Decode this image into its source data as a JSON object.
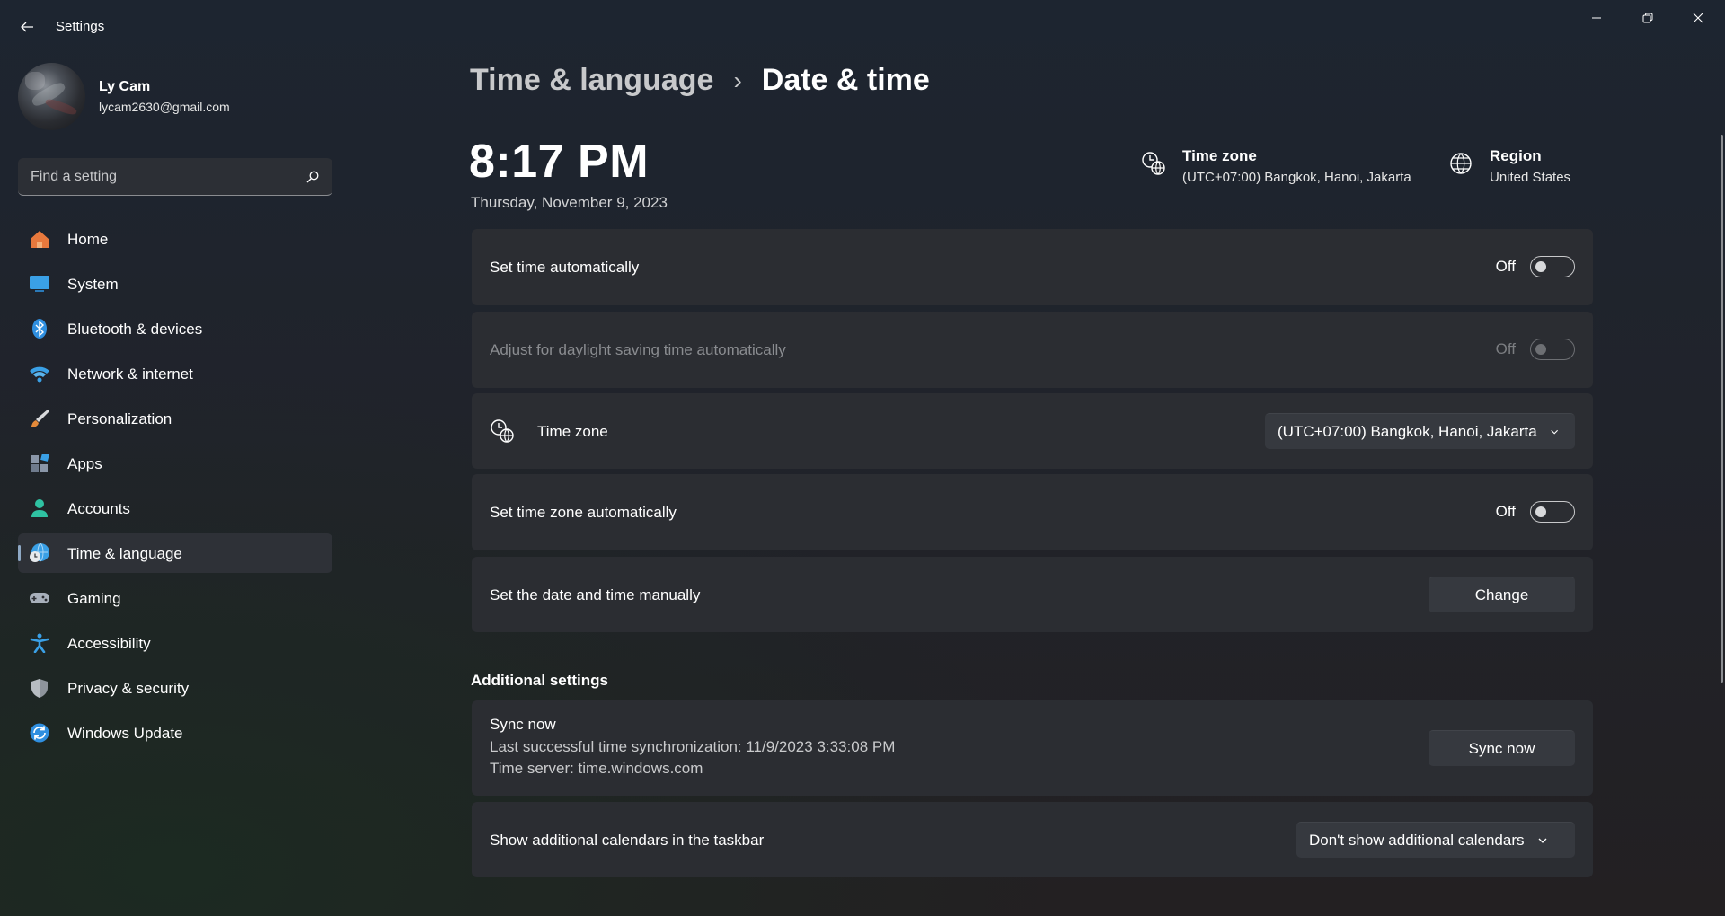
{
  "window": {
    "title": "Settings",
    "back_icon": "arrow-left-icon",
    "controls": [
      "minimize-icon",
      "restore-icon",
      "close-icon"
    ]
  },
  "profile": {
    "name": "Ly Cam",
    "email": "lycam2630@gmail.com"
  },
  "search": {
    "placeholder": "Find a setting",
    "icon": "search-icon"
  },
  "nav": {
    "items": [
      {
        "label": "Home",
        "icon": "home-icon",
        "color": "#e8793d"
      },
      {
        "label": "System",
        "icon": "monitor-icon",
        "color": "#3aa0e6"
      },
      {
        "label": "Bluetooth & devices",
        "icon": "bluetooth-icon",
        "color": "#2f8fe0"
      },
      {
        "label": "Network & internet",
        "icon": "wifi-icon",
        "color": "#3aa0e6"
      },
      {
        "label": "Personalization",
        "icon": "brush-icon",
        "color": "#e48a3a"
      },
      {
        "label": "Apps",
        "icon": "apps-icon",
        "color": "#8a96a8"
      },
      {
        "label": "Accounts",
        "icon": "person-icon",
        "color": "#2fc2a2"
      },
      {
        "label": "Time & language",
        "icon": "globe-clock-icon",
        "color": "#3aa0e6",
        "active": true
      },
      {
        "label": "Gaming",
        "icon": "gamepad-icon",
        "color": "#a8b0bb"
      },
      {
        "label": "Accessibility",
        "icon": "accessibility-icon",
        "color": "#3aa0e6"
      },
      {
        "label": "Privacy & security",
        "icon": "shield-icon",
        "color": "#8e949c"
      },
      {
        "label": "Windows Update",
        "icon": "refresh-icon",
        "color": "#2f8fe0"
      }
    ]
  },
  "breadcrumb": {
    "parent": "Time & language",
    "separator": "›",
    "current": "Date & time"
  },
  "clock": {
    "time": "8:17 PM",
    "date": "Thursday, November 9, 2023"
  },
  "header_info": {
    "timezone": {
      "title": "Time zone",
      "value": "(UTC+07:00) Bangkok, Hanoi, Jakarta",
      "icon": "globe-clock-icon"
    },
    "region": {
      "title": "Region",
      "value": "United States",
      "icon": "globe-icon"
    }
  },
  "settings": {
    "set_time_auto": {
      "label": "Set time automatically",
      "state": "Off"
    },
    "daylight_saving": {
      "label": "Adjust for daylight saving time automatically",
      "state": "Off",
      "disabled": true
    },
    "time_zone": {
      "label": "Time zone",
      "value": "(UTC+07:00) Bangkok, Hanoi, Jakarta"
    },
    "set_timezone_auto": {
      "label": "Set time zone automatically",
      "state": "Off"
    },
    "manual": {
      "label": "Set the date and time manually",
      "button": "Change"
    }
  },
  "additional": {
    "title": "Additional settings",
    "sync": {
      "title": "Sync now",
      "last_sync": "Last successful time synchronization: 11/9/2023 3:33:08 PM",
      "server": "Time server: time.windows.com",
      "button": "Sync now"
    },
    "calendars": {
      "label": "Show additional calendars in the taskbar",
      "value": "Don't show additional calendars"
    }
  }
}
